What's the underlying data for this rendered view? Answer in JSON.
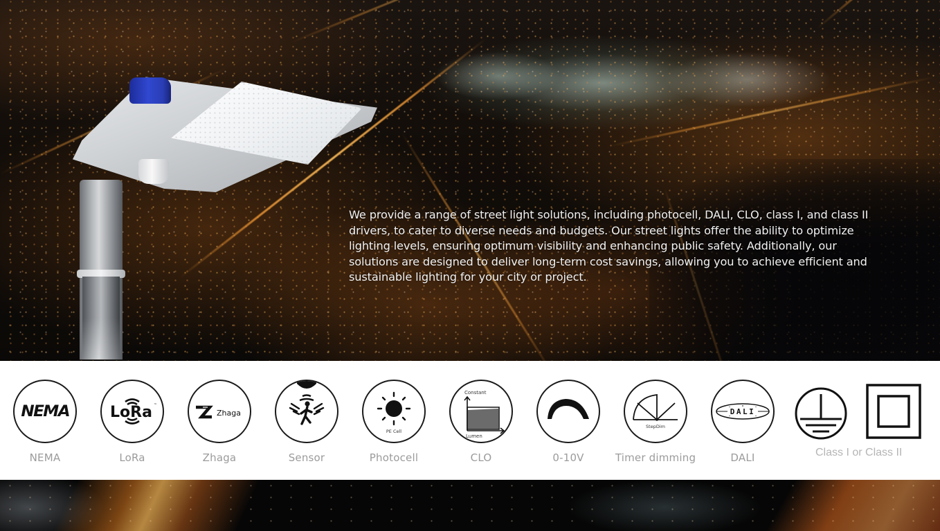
{
  "hero": {
    "description": "We provide a range of street light solutions, including photocell, DALI, CLO, class I, and class II drivers, to cater to diverse needs and budgets. Our street lights offer the ability to optimize lighting levels, ensuring optimum visibility and enhancing public safety. Additionally, our solutions are designed to deliver long-term cost savings, allowing you to achieve efficient and sustainable lighting for your city or project."
  },
  "features": [
    {
      "label": "NEMA",
      "icon": "nema-logo-icon",
      "logo_text": "NEMA"
    },
    {
      "label": "LoRa",
      "icon": "lora-logo-icon",
      "logo_text": "LoRa",
      "trademark": "™"
    },
    {
      "label": "Zhaga",
      "icon": "zhaga-logo-icon",
      "logo_text": "Zhaga"
    },
    {
      "label": "Sensor",
      "icon": "motion-sensor-icon"
    },
    {
      "label": "Photocell",
      "icon": "photocell-sun-icon",
      "caption": "PE Cell"
    },
    {
      "label": "CLO",
      "icon": "clo-chart-icon",
      "caption_top": "Constant",
      "caption_bottom": "Lumen"
    },
    {
      "label": "0-10V",
      "icon": "dimming-arc-icon"
    },
    {
      "label": "Timer dimming",
      "icon": "stepdim-icon",
      "caption": "StepDim"
    },
    {
      "label": "DALI",
      "icon": "dali-logo-icon",
      "logo_text": "DALI"
    }
  ],
  "class_group": {
    "label": "Class I or Class II",
    "icons": [
      "protective-earth-icon",
      "double-insulation-icon"
    ]
  },
  "colors": {
    "icon_stroke": "#1a1a1a",
    "label_gray": "#9b9b9b",
    "band_background": "#ffffff",
    "description_text": "#f1f1f1",
    "lamp_cap_blue": "#3048d0"
  }
}
